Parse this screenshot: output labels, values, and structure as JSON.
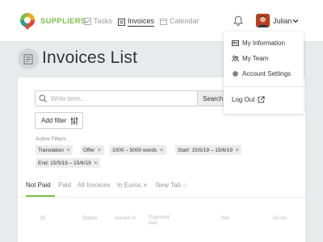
{
  "brand": {
    "name": "SUPPLIERS"
  },
  "nav": {
    "tasks": "Tasks",
    "invoices": "Invoices",
    "calendar": "Calendar"
  },
  "user": {
    "name": "Julian"
  },
  "page": {
    "title": "Invoices List"
  },
  "search": {
    "placeholder": "Write term...",
    "button": "Search"
  },
  "filters": {
    "add_label": "Add filter",
    "active_label": "Active Filters:",
    "chips": [
      "Translation",
      "Offer",
      "1000 – 5000 words",
      "Start: 15/5/19 – 15/6/19",
      "End: 15/5/19 – 15/6/19"
    ]
  },
  "tabs": [
    "Not Paid",
    "Paid",
    "All Invoices",
    "In Euros",
    "New Tab"
  ],
  "table": {
    "columns": [
      "ID",
      "Status",
      "Issued in",
      "Payment due",
      "Net",
      "Gross"
    ]
  },
  "dropdown": {
    "items": [
      "My Information",
      "My Team",
      "Account Settings",
      "Log Out"
    ]
  },
  "colors": {
    "accent": "#7cc04a",
    "background": "#e9eaec"
  }
}
